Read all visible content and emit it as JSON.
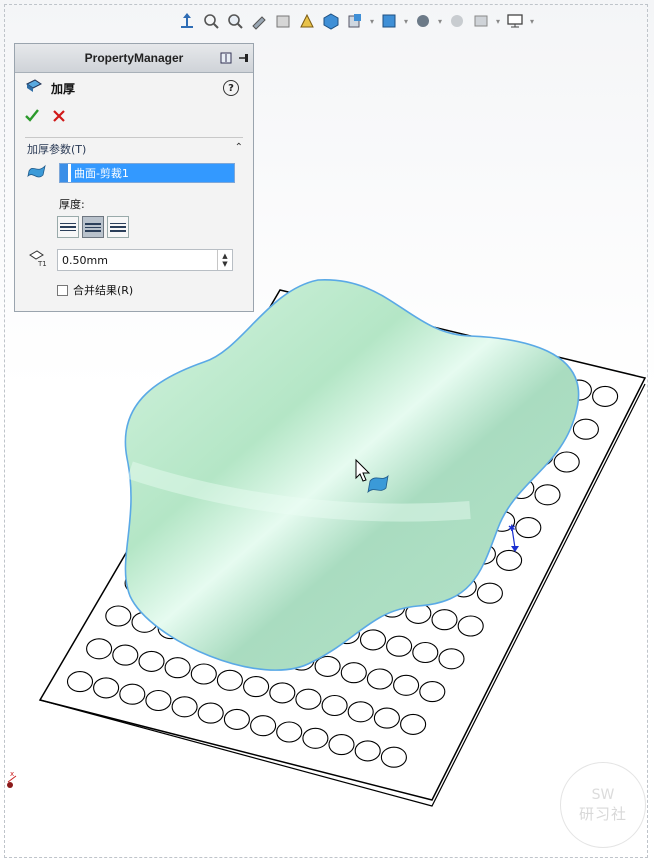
{
  "property_manager": {
    "header_title": "PropertyManager",
    "feature_title": "加厚",
    "help_icon": "?",
    "ok_icon": "checkmark-icon",
    "cancel_icon": "close-icon",
    "group": {
      "title": "加厚参数(T)",
      "selection_item": "曲面-剪裁1",
      "thickness_label": "厚度:",
      "thickness_options": [
        "thicken-side-1",
        "thicken-both-sides",
        "thicken-side-2"
      ],
      "thickness_selected": 1,
      "thickness_value": "0.50mm",
      "merge_result_label": "合并结果(R)",
      "merge_result_checked": false
    }
  },
  "watermark": {
    "top": "SW",
    "bottom": "研习社"
  },
  "colors": {
    "surface_fill": "#b9ebcf",
    "surface_edge": "#5aa9e6",
    "plate_fill": "#ffffff",
    "plate_edge": "#000000",
    "selection_blue": "#3399ff"
  }
}
